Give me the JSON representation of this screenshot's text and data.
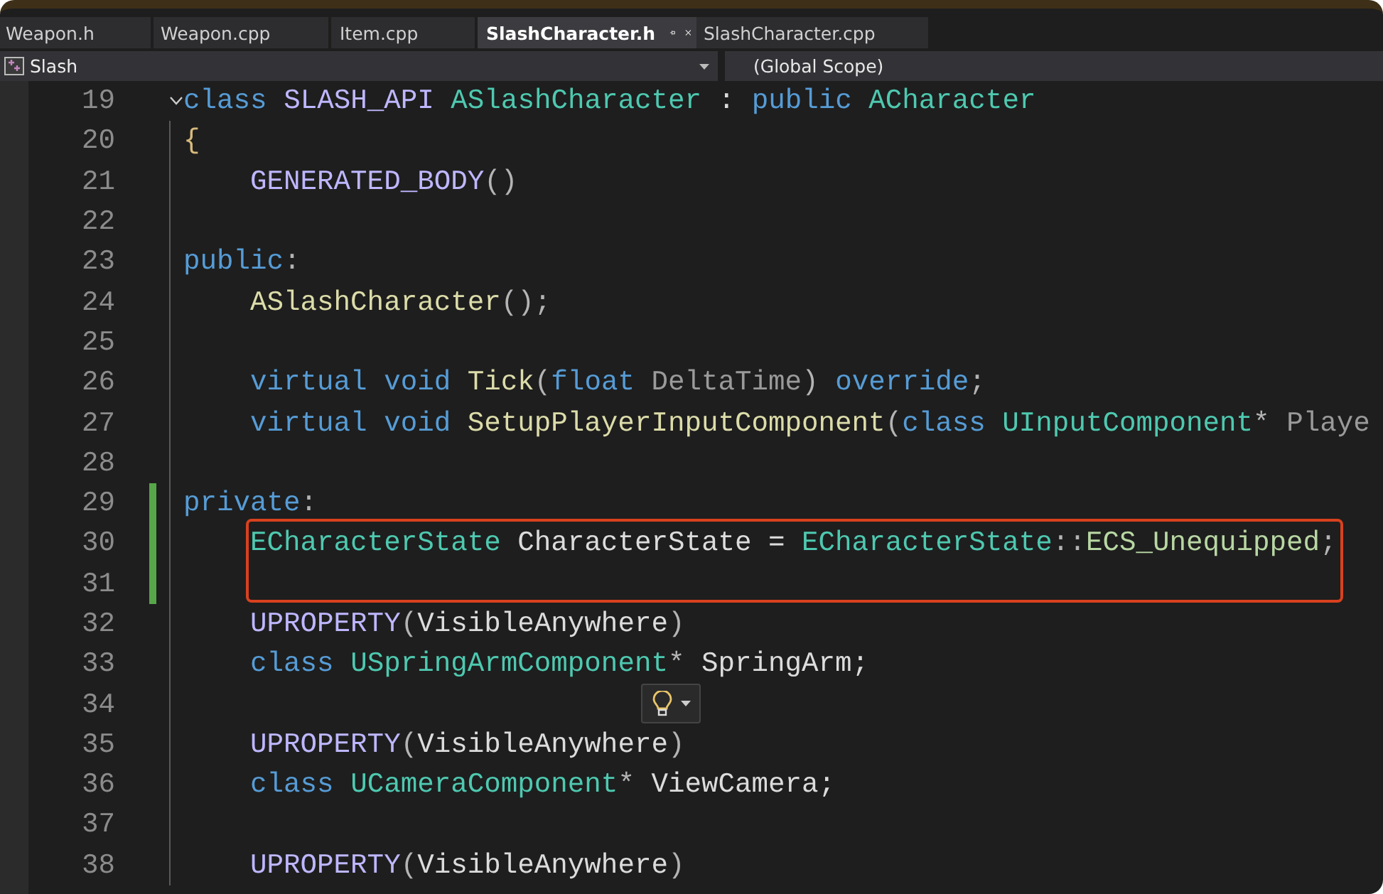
{
  "tabs": [
    {
      "label": "Weapon.h",
      "selected": false,
      "pinned": false
    },
    {
      "label": "Weapon.cpp",
      "selected": false,
      "pinned": false
    },
    {
      "label": "Item.cpp",
      "selected": false,
      "pinned": false
    },
    {
      "label": "SlashCharacter.h",
      "selected": true,
      "pinned": true
    },
    {
      "label": "SlashCharacter.cpp",
      "selected": false,
      "pinned": false
    }
  ],
  "navigation_bar": {
    "project": "Slash",
    "scope": "(Global Scope)"
  },
  "editor": {
    "lines": [
      {
        "number": "19",
        "changed": false,
        "boxed": false,
        "indented": false,
        "expanded": true,
        "tokens": [
          {
            "kind": "keyword",
            "text": "class "
          },
          {
            "kind": "macro",
            "text": "SLASH_API "
          },
          {
            "kind": "type",
            "text": "ASlashCharacter"
          },
          {
            "kind": "plain",
            "text": " : "
          },
          {
            "kind": "keyword",
            "text": "public "
          },
          {
            "kind": "type",
            "text": "ACharacter"
          }
        ]
      },
      {
        "number": "20",
        "changed": false,
        "boxed": false,
        "indented": false,
        "tokens": [
          {
            "kind": "brace",
            "text": "{"
          }
        ]
      },
      {
        "number": "21",
        "changed": false,
        "boxed": false,
        "indented": true,
        "tokens": [
          {
            "kind": "macro",
            "text": "GENERATED_BODY"
          },
          {
            "kind": "punct",
            "text": "()"
          }
        ]
      },
      {
        "number": "22",
        "changed": false,
        "boxed": false,
        "indented": false
      },
      {
        "number": "23",
        "changed": false,
        "boxed": false,
        "indented": false,
        "tokens": [
          {
            "kind": "keyword",
            "text": "public"
          },
          {
            "kind": "punct",
            "text": ":"
          }
        ]
      },
      {
        "number": "24",
        "changed": false,
        "boxed": false,
        "indented": true,
        "tokens": [
          {
            "kind": "function",
            "text": "ASlashCharacter"
          },
          {
            "kind": "punct",
            "text": "();"
          }
        ]
      },
      {
        "number": "25",
        "changed": false,
        "boxed": false,
        "indented": false
      },
      {
        "number": "26",
        "changed": false,
        "boxed": false,
        "indented": true,
        "tokens": [
          {
            "kind": "keyword",
            "text": "virtual void "
          },
          {
            "kind": "function",
            "text": "Tick"
          },
          {
            "kind": "punct",
            "text": "("
          },
          {
            "kind": "keyword",
            "text": "float "
          },
          {
            "kind": "param",
            "text": "DeltaTime"
          },
          {
            "kind": "punct",
            "text": ") "
          },
          {
            "kind": "keyword",
            "text": "override"
          },
          {
            "kind": "punct",
            "text": ";"
          }
        ]
      },
      {
        "number": "27",
        "changed": false,
        "boxed": false,
        "indented": true,
        "tokens": [
          {
            "kind": "keyword",
            "text": "virtual void "
          },
          {
            "kind": "function",
            "text": "SetupPlayerInputComponent"
          },
          {
            "kind": "punct",
            "text": "("
          },
          {
            "kind": "keyword",
            "text": "class "
          },
          {
            "kind": "type",
            "text": "UInputComponent"
          },
          {
            "kind": "punct",
            "text": "* "
          },
          {
            "kind": "param",
            "text": "Playe"
          }
        ]
      },
      {
        "number": "28",
        "changed": false,
        "boxed": false,
        "indented": false
      },
      {
        "number": "29",
        "changed": true,
        "boxed": false,
        "indented": false,
        "tokens": [
          {
            "kind": "keyword",
            "text": "private"
          },
          {
            "kind": "punct",
            "text": ":"
          }
        ]
      },
      {
        "number": "30",
        "changed": true,
        "boxed": true,
        "indented": true,
        "tokens": [
          {
            "kind": "type",
            "text": "ECharacterState"
          },
          {
            "kind": "plain",
            "text": " CharacterState = "
          },
          {
            "kind": "type",
            "text": "ECharacterState"
          },
          {
            "kind": "punct",
            "text": "::"
          },
          {
            "kind": "enum",
            "text": "ECS_Unequipped"
          },
          {
            "kind": "punct",
            "text": ";"
          }
        ]
      },
      {
        "number": "31",
        "changed": true,
        "boxed": true,
        "indented": false
      },
      {
        "number": "32",
        "changed": false,
        "boxed": false,
        "indented": true,
        "tokens": [
          {
            "kind": "macro",
            "text": "UPROPERTY"
          },
          {
            "kind": "punct",
            "text": "("
          },
          {
            "kind": "plain",
            "text": "VisibleAnywhere"
          },
          {
            "kind": "punct",
            "text": ")"
          }
        ]
      },
      {
        "number": "33",
        "changed": false,
        "boxed": false,
        "indented": true,
        "tokens": [
          {
            "kind": "keyword",
            "text": "class "
          },
          {
            "kind": "type",
            "text": "USpringArmComponent"
          },
          {
            "kind": "punct",
            "text": "*"
          },
          {
            "kind": "plain",
            "text": " SpringArm;"
          }
        ]
      },
      {
        "number": "34",
        "changed": false,
        "boxed": false,
        "indented": false,
        "lightbulb": true
      },
      {
        "number": "35",
        "changed": false,
        "boxed": false,
        "indented": true,
        "tokens": [
          {
            "kind": "macro",
            "text": "UPROPERTY"
          },
          {
            "kind": "punct",
            "text": "("
          },
          {
            "kind": "plain",
            "text": "VisibleAnywhere"
          },
          {
            "kind": "punct",
            "text": ")"
          }
        ]
      },
      {
        "number": "36",
        "changed": false,
        "boxed": false,
        "indented": true,
        "tokens": [
          {
            "kind": "keyword",
            "text": "class "
          },
          {
            "kind": "type",
            "text": "UCameraComponent"
          },
          {
            "kind": "punct",
            "text": "*"
          },
          {
            "kind": "plain",
            "text": " ViewCamera;"
          }
        ]
      },
      {
        "number": "37",
        "changed": false,
        "boxed": false,
        "indented": false
      },
      {
        "number": "38",
        "changed": false,
        "boxed": false,
        "indented": true,
        "tokens": [
          {
            "kind": "macro",
            "text": "UPROPERTY"
          },
          {
            "kind": "punct",
            "text": "("
          },
          {
            "kind": "plain",
            "text": "VisibleAnywhere"
          },
          {
            "kind": "punct",
            "text": ")"
          }
        ]
      }
    ]
  }
}
